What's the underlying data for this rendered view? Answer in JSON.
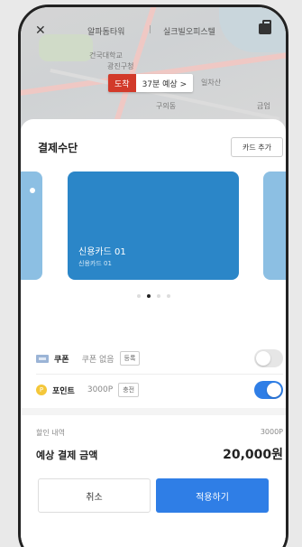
{
  "header": {
    "origin": "알파돔타워",
    "separator": "|",
    "destination": "실크빌오피스텔"
  },
  "map": {
    "labels": [
      "건국대학교",
      "광진구청",
      "일차산",
      "구의동",
      "금업"
    ],
    "arrival_tag": "도착",
    "eta": "37분 예상 >"
  },
  "payment": {
    "section_title": "결제수단",
    "add_card_label": "카드 추가",
    "cards": [
      {
        "name": "신용카드 01",
        "sub": "신용카드 01"
      }
    ],
    "pages": 4,
    "active_page": 2
  },
  "coupon": {
    "title": "쿠폰",
    "value": "쿠폰 없음",
    "button": "등록",
    "enabled": false
  },
  "point": {
    "icon_text": "P",
    "title": "포인트",
    "value": "3000P",
    "button": "충전",
    "enabled": true
  },
  "summary": {
    "discount_label": "할인 내역",
    "discount_value": "3000P",
    "total_label": "예상 결제 금액",
    "total_value": "20,000원"
  },
  "actions": {
    "cancel": "취소",
    "apply": "적용하기"
  },
  "colors": {
    "accent": "#2f7ee6",
    "card": "#2b86c8",
    "arrival": "#d23a2a"
  }
}
